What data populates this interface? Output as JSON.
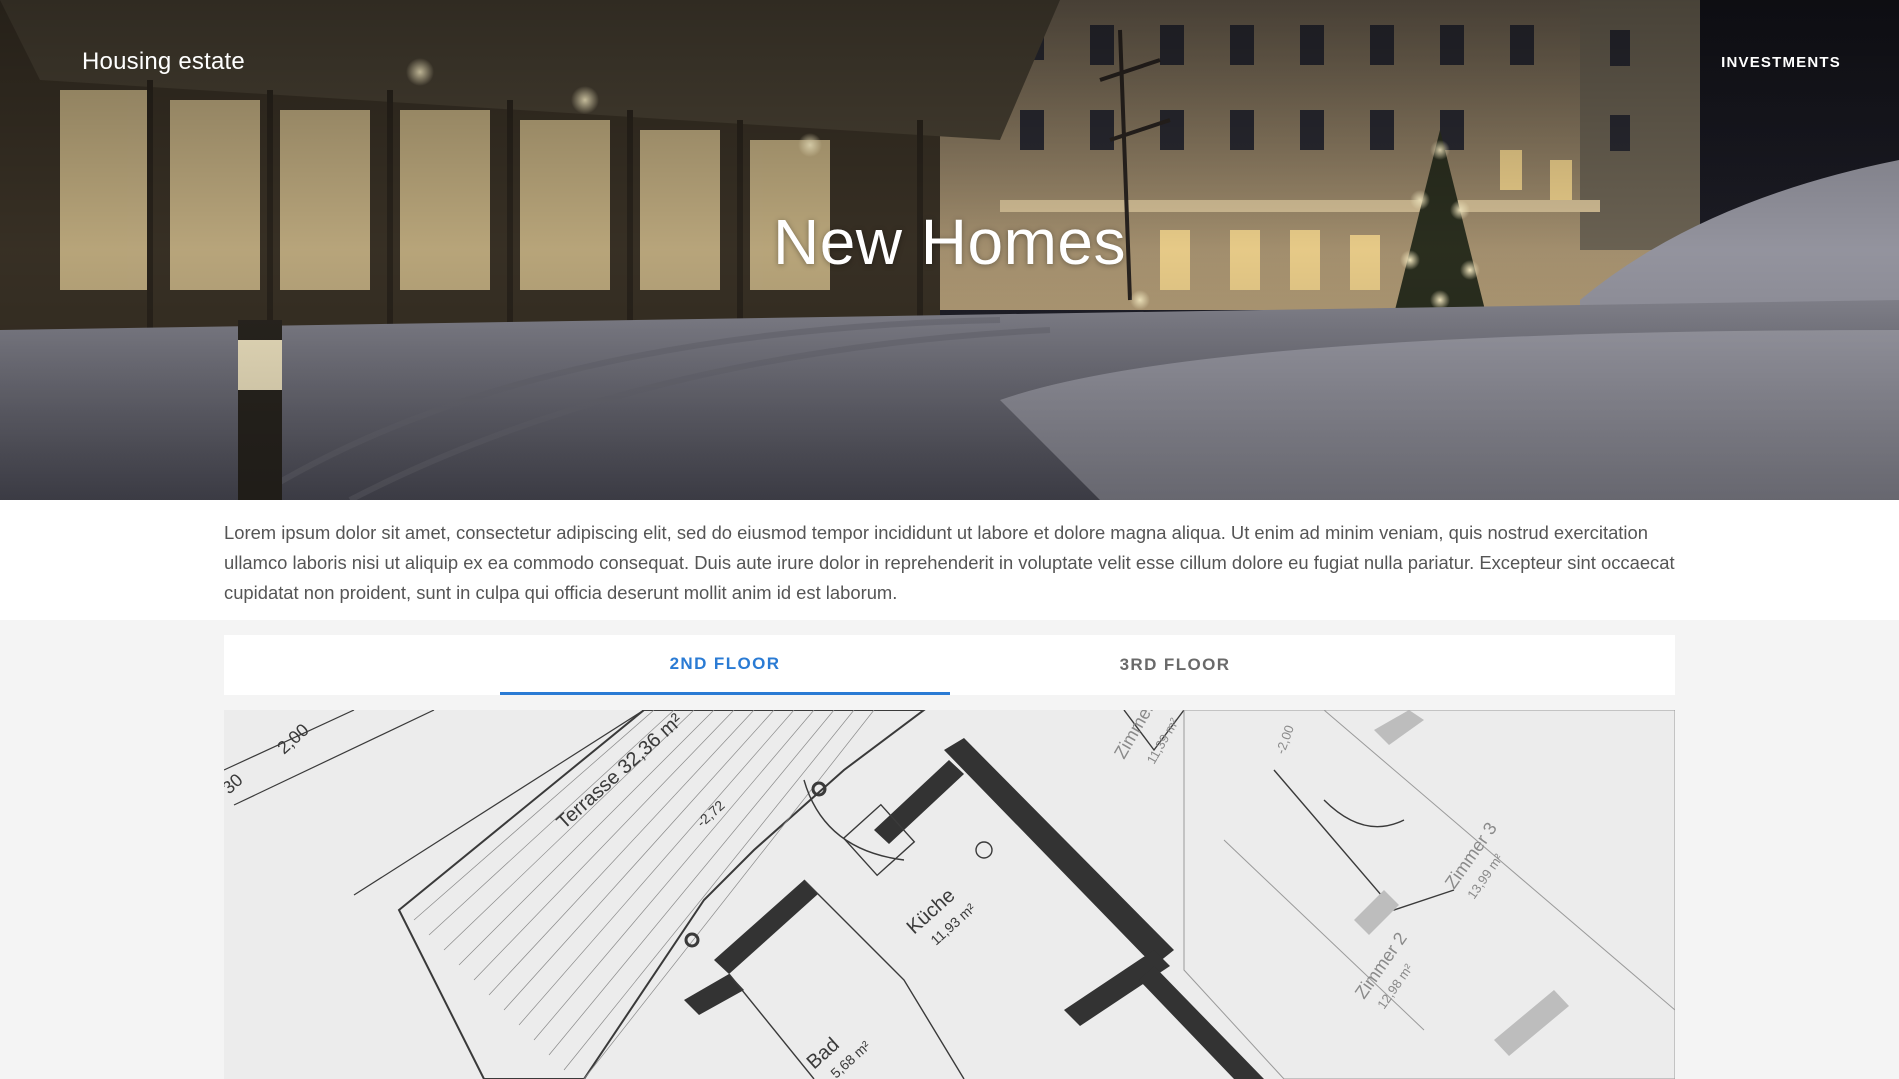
{
  "header": {
    "brand": "Housing estate",
    "nav": {
      "investments": "INVESTMENTS"
    }
  },
  "hero": {
    "title": "New Homes"
  },
  "intro": {
    "text": "Lorem ipsum dolor sit amet, consectetur adipiscing elit, sed do eiusmod tempor incididunt ut labore et dolore magna aliqua. Ut enim ad minim veniam, quis nostrud exercitation ullamco laboris nisi ut aliquip ex ea commodo consequat. Duis aute irure dolor in reprehenderit in voluptate velit esse cillum dolore eu fugiat nulla pariatur. Excepteur sint occaecat cupidatat non proident, sunt in culpa qui officia deserunt mollit anim id est laborum."
  },
  "tabs": {
    "active_index": 0,
    "items": [
      {
        "label": "2ND FLOOR"
      },
      {
        "label": "3RD FLOOR"
      }
    ]
  },
  "floor_plan": {
    "labels": {
      "terrace": "Terrasse 32,36 m²",
      "terrace_level": "-2,72",
      "kitchen": "Küche",
      "kitchen_area": "11,93 m²",
      "bath": "Bad",
      "bath_area": "5,68 m²",
      "room1": "Zimmer",
      "room1_area": "11,39 m²",
      "room2": "Zimmer 2",
      "room2_area": "12,98 m²",
      "room3": "Zimmer 3",
      "room3_area": "13,99 m²",
      "dim_a": "2,00",
      "dim_b": "30",
      "dim_c": "-2,00"
    }
  },
  "colors": {
    "accent": "#2a7bd4",
    "tab_inactive": "#6a6a6a",
    "body_text": "#555555",
    "page_bg": "#f4f4f4"
  }
}
